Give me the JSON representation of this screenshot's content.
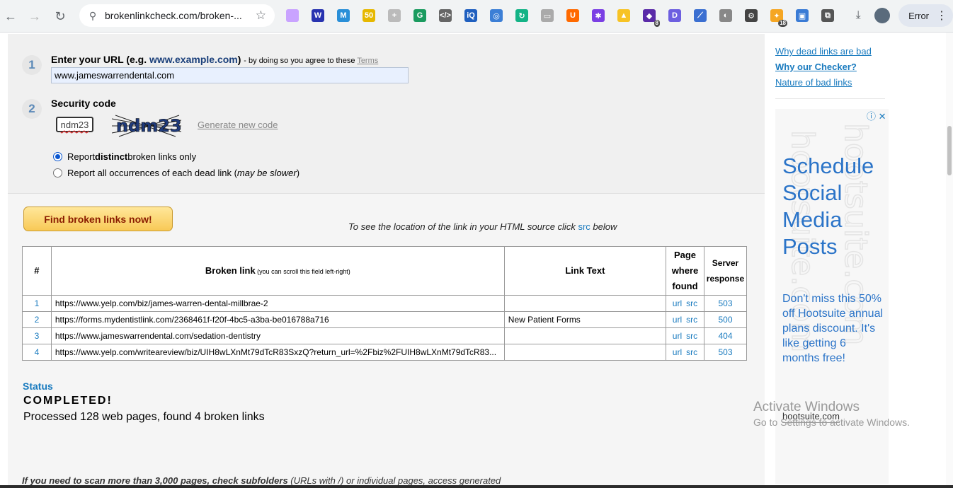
{
  "browser": {
    "url": "brokenlinkcheck.com/broken-...",
    "error_label": "Error",
    "extensions": [
      {
        "name": "ext-1",
        "color": "#c9a3ff",
        "glyph": ""
      },
      {
        "name": "ext-2",
        "color": "#2833b0",
        "glyph": "W"
      },
      {
        "name": "ext-3",
        "color": "#2a8fd8",
        "glyph": "M"
      },
      {
        "name": "ext-4",
        "color": "#e6b800",
        "glyph": "50"
      },
      {
        "name": "ext-5",
        "color": "#bbbbbb",
        "glyph": "+"
      },
      {
        "name": "ext-6",
        "color": "#1a9b5f",
        "glyph": "G"
      },
      {
        "name": "ext-7",
        "color": "#666666",
        "glyph": "</>"
      },
      {
        "name": "ext-8",
        "color": "#1f5fbf",
        "glyph": "iQ"
      },
      {
        "name": "ext-9",
        "color": "#3c7fd6",
        "glyph": "◎"
      },
      {
        "name": "ext-10",
        "color": "#13b386",
        "glyph": "↻"
      },
      {
        "name": "ext-11",
        "color": "#aaaaaa",
        "glyph": "▭"
      },
      {
        "name": "ext-12",
        "color": "#ff6a00",
        "glyph": "U"
      },
      {
        "name": "ext-13",
        "color": "#7b3fe4",
        "glyph": "✱"
      },
      {
        "name": "ext-14",
        "color": "#f7c325",
        "glyph": "▲"
      },
      {
        "name": "ext-15",
        "color": "#5a2aa8",
        "glyph": "◆",
        "badge": "8"
      },
      {
        "name": "ext-16",
        "color": "#6d5fe0",
        "glyph": "D"
      },
      {
        "name": "ext-17",
        "color": "#3b6fd1",
        "glyph": "⟋"
      },
      {
        "name": "ext-18",
        "color": "#888888",
        "glyph": "◐"
      },
      {
        "name": "ext-19",
        "color": "#444444",
        "glyph": "⚙"
      },
      {
        "name": "ext-20",
        "color": "#f5a623",
        "glyph": "✦",
        "badge": "18"
      },
      {
        "name": "ext-21",
        "color": "#3a7bd5",
        "glyph": "▣"
      },
      {
        "name": "ext-22",
        "color": "#555555",
        "glyph": "⧉"
      }
    ]
  },
  "form": {
    "step1": "1",
    "step2": "2",
    "url_label_a": "Enter your URL (e.g. ",
    "url_label_example": "www.example.com",
    "url_label_b": ") ",
    "url_label_agree": "- by doing so you agree to these ",
    "terms_link": "Terms",
    "url_value": "www.jameswarrendental.com",
    "security_label": "Security code",
    "code_value": "ndm23",
    "captcha_text": "ndm23",
    "generate_link": "Generate new code",
    "radio1_a": "Report ",
    "radio1_b": "distinct",
    "radio1_c": " broken links only",
    "radio2_a": "Report all occurrences of each dead link (",
    "radio2_b": "may be slower",
    "radio2_c": ")"
  },
  "actions": {
    "find_button": "Find broken links now!",
    "hint_a": "To see the location of the link in your HTML source click ",
    "hint_src": "src",
    "hint_b": " below"
  },
  "table": {
    "col_num": "#",
    "col_link": "Broken link",
    "col_link_note": " (you can scroll this field left-right)",
    "col_text": "Link Text",
    "col_page_1": "Page",
    "col_page_2": "where",
    "col_page_3": "found",
    "col_resp_1": "Server",
    "col_resp_2": "response",
    "url_label": "url",
    "src_label": "src",
    "rows": [
      {
        "num": "1",
        "link": "https://www.yelp.com/biz/james-warren-dental-millbrae-2",
        "text": "",
        "response": "503"
      },
      {
        "num": "2",
        "link": "https://forms.mydentistlink.com/2368461f-f20f-4bc5-a3ba-be016788a716",
        "text": "New Patient Forms",
        "response": "500"
      },
      {
        "num": "3",
        "link": "https://www.jameswarrendental.com/sedation-dentistry",
        "text": "",
        "response": "404"
      },
      {
        "num": "4",
        "link": "https://www.yelp.com/writeareview/biz/UIH8wLXnMt79dTcR83SxzQ?return_url=%2Fbiz%2FUIH8wLXnMt79dTcR83...",
        "text": "",
        "response": "503"
      }
    ]
  },
  "status": {
    "heading": "Status",
    "value": "COMPLETED!",
    "processed": "Processed 128 web pages, found 4 broken links"
  },
  "footer": {
    "note_bold": "If you need to scan more than 3,000 pages, check subfolders",
    "note_normal": " (URLs with /) or individual pages, access generated"
  },
  "sidebar": {
    "links": [
      "Why dead links are bad",
      "Why our Checker?",
      "Nature of bad links"
    ]
  },
  "ad": {
    "headline": "Schedule Social Media Posts",
    "body": "Don't miss this 50% off Hootsuite annual plans discount. It's like getting 6 months free!",
    "brand": "hootsuite.com",
    "close": "ⓘ ✕"
  },
  "windows_notice": {
    "line1": "Activate Windows",
    "line2": "Go to Settings to activate Windows."
  }
}
